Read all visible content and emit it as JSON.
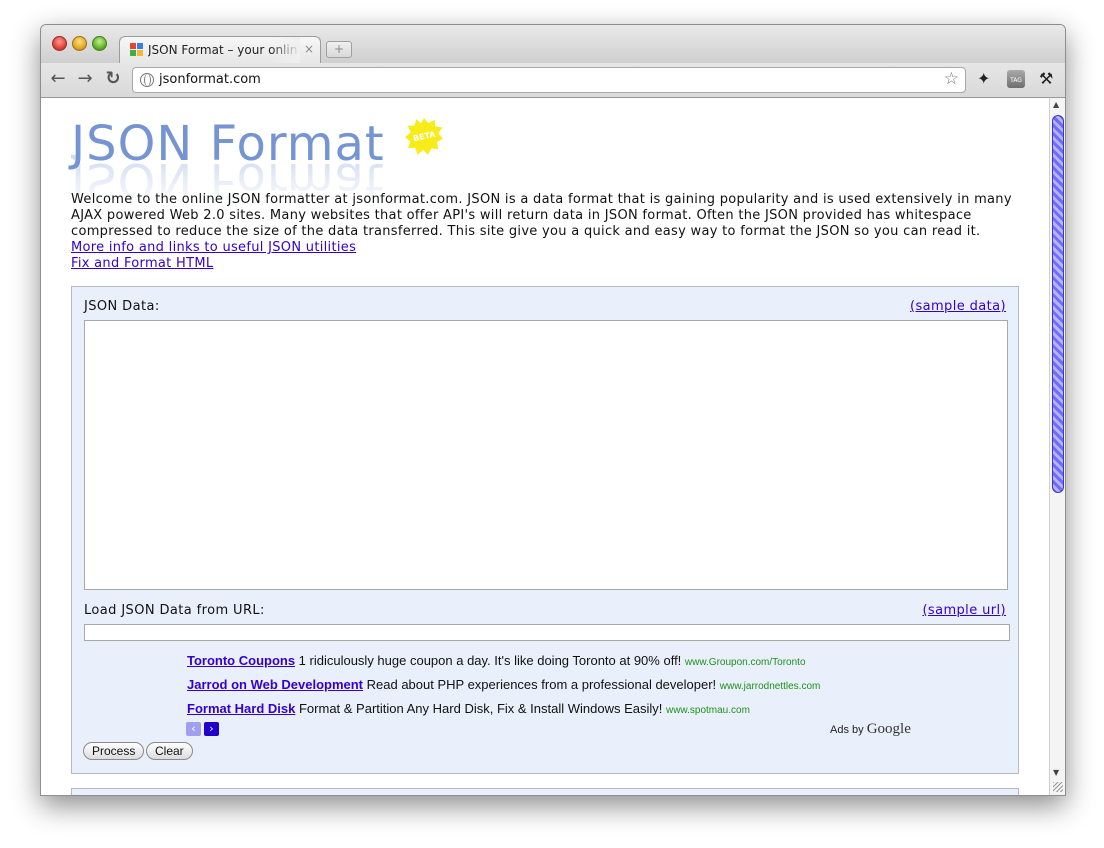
{
  "browser": {
    "tab_title": "JSON Format – your online JS",
    "tab_close": "×",
    "new_tab": "+",
    "url": "jsonformat.com",
    "tag_icon_text": "TAG"
  },
  "logo": {
    "title": "JSON Format",
    "badge": "BETA"
  },
  "intro": {
    "text": "Welcome to the online JSON formatter at jsonformat.com. JSON is a data format that is gaining popularity and is used extensively in many AJAX powered Web 2.0 sites. Many websites that offer API's will return data in JSON format. Often the JSON provided has whitespace compressed to reduce the size of the data transferred. This site give you a quick and easy way to format the JSON so you can read it.",
    "link_more": "More info and links to useful JSON utilities",
    "link_html": "Fix and Format HTML"
  },
  "form": {
    "json_label": "JSON Data:",
    "sample_data": "(sample data)",
    "url_label": "Load JSON Data from URL:",
    "sample_url": "(sample url)",
    "process": "Process",
    "clear": "Clear"
  },
  "ads": {
    "items": [
      {
        "title": "Toronto Coupons",
        "text": " 1 ridiculously huge coupon a day. It's like doing Toronto at 90% off! ",
        "url": "www.Groupon.com/Toronto"
      },
      {
        "title": "Jarrod on Web Development",
        "text": " Read about PHP experiences from a professional developer! ",
        "url": "www.jarrodnettles.com"
      },
      {
        "title": "Format Hard Disk",
        "text": " Format & Partition Any Hard Disk, Fix & Install Windows Easily! ",
        "url": "www.spotmau.com"
      }
    ],
    "ads_by": "Ads by",
    "google": "Google",
    "prev": "‹",
    "next": "›"
  }
}
